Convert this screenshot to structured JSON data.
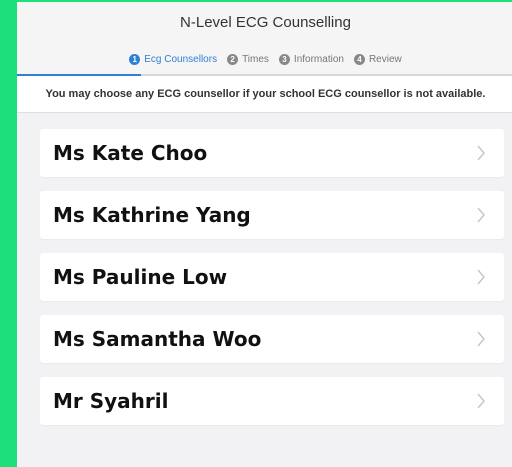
{
  "header": {
    "title": "N-Level ECG Counselling"
  },
  "steps": [
    {
      "num": "1",
      "label": "Ecg Counsellors"
    },
    {
      "num": "2",
      "label": "Times"
    },
    {
      "num": "3",
      "label": "Information"
    },
    {
      "num": "4",
      "label": "Review"
    }
  ],
  "progress": {
    "fraction": 0.25
  },
  "notice": "You may choose any ECG counsellor if your school ECG counsellor is not available.",
  "counsellors": [
    {
      "name": "Ms Kate Choo"
    },
    {
      "name": "Ms Kathrine Yang"
    },
    {
      "name": "Ms Pauline Low"
    },
    {
      "name": "Ms Samantha Woo"
    },
    {
      "name": "Mr Syahril"
    }
  ],
  "colors": {
    "accent": "#2f7fd4",
    "background": "#1ee07a"
  },
  "icons": {
    "row_arrow": "chevron-right-icon"
  }
}
